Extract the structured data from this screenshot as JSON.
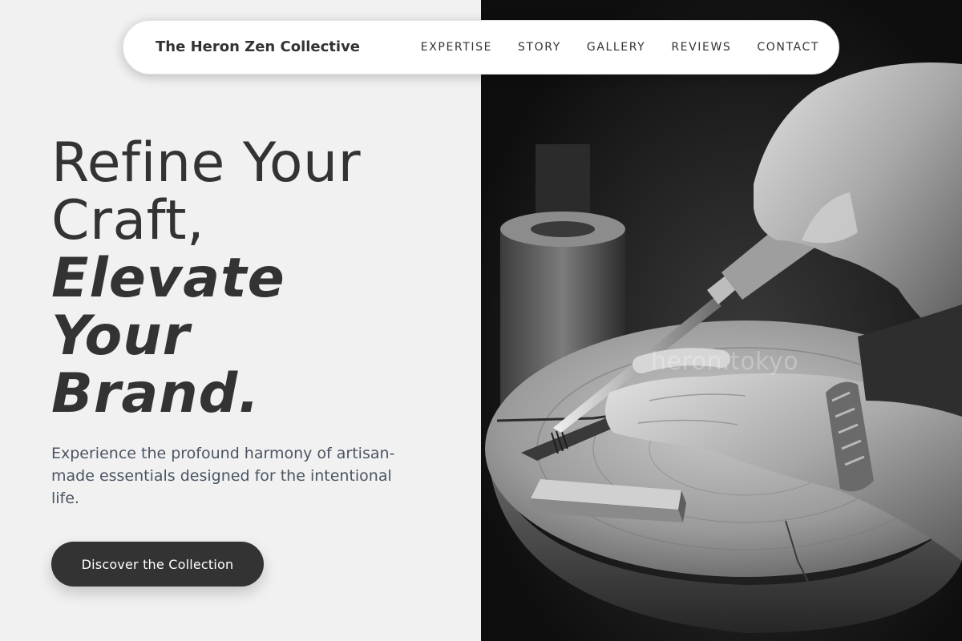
{
  "nav": {
    "brand": "The Heron Zen Collective",
    "links": [
      "EXPERTISE",
      "STORY",
      "GALLERY",
      "REVIEWS",
      "CONTACT"
    ]
  },
  "hero": {
    "headline_line1": "Refine Your",
    "headline_line2": "Craft,",
    "headline_em1": "Elevate",
    "headline_em2": "Your",
    "headline_em3": "Brand.",
    "subcopy": "Experience the profound harmony of artisan-made essentials designed for the intentional life.",
    "cta_label": "Discover the Collection"
  },
  "photo": {
    "watermark": "heron.tokyo"
  },
  "colors": {
    "background": "#f1f1f1",
    "text_dark": "#333333",
    "subcopy": "#4a5563",
    "button": "#333333"
  }
}
